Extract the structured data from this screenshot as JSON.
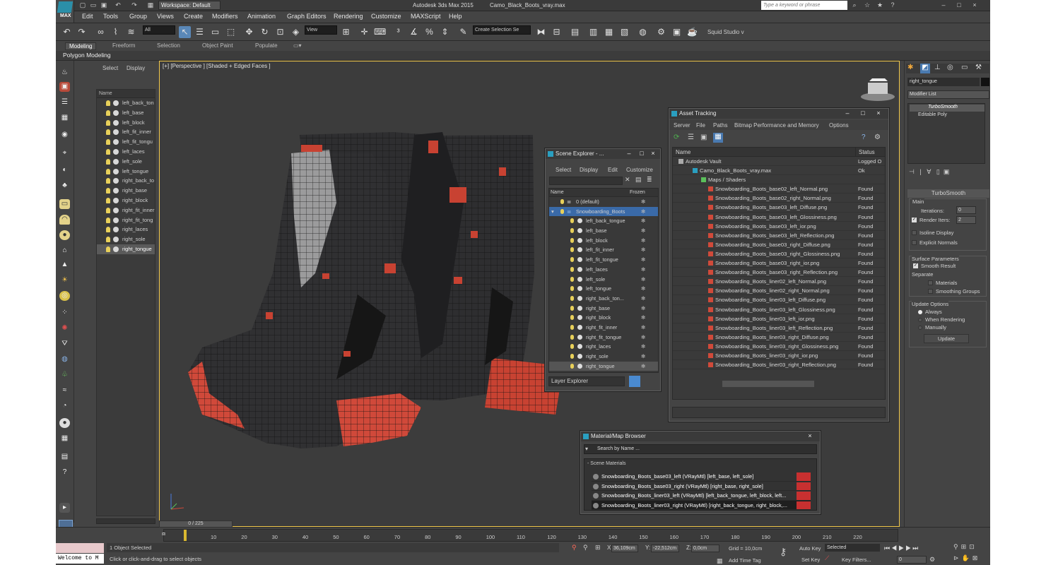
{
  "app": {
    "title": "Autodesk 3ds Max 2015",
    "file": "Camo_Black_Boots_vray.max",
    "logo": "MAX",
    "search_placeholder": "Type a keyword or phrase",
    "workspace": "Workspace: Default"
  },
  "menu": [
    "Edit",
    "Tools",
    "Group",
    "Views",
    "Create",
    "Modifiers",
    "Animation",
    "Graph Editors",
    "Rendering",
    "Customize",
    "MAXScript",
    "Help"
  ],
  "toolbar": {
    "filter": "All",
    "view": "View",
    "selection_set": "Create Selection Se",
    "squid": "Squid Studio v"
  },
  "ribbon": {
    "tabs": [
      "Modeling",
      "Freeform",
      "Selection",
      "Object Paint",
      "Populate"
    ],
    "active": "Modeling",
    "sub": "Polygon Modeling"
  },
  "left_panel": {
    "tabs": [
      "Select",
      "Display"
    ],
    "col": "Name",
    "items": [
      "left_back_ton",
      "left_base",
      "left_block",
      "left_fit_inner",
      "left_fit_tongu",
      "left_laces",
      "left_sole",
      "left_tongue",
      "right_back_to",
      "right_base",
      "right_block",
      "right_fit_inner",
      "right_fit_tong",
      "right_laces",
      "right_sole",
      "right_tongue"
    ],
    "selected": "right_tongue"
  },
  "viewport": {
    "label": "[+] [Perspective ] [Shaded + Edged Faces ]",
    "time": "0 / 225"
  },
  "scene_explorer": {
    "title": "Scene Explorer - ...",
    "menu": [
      "Select",
      "Display",
      "Edit",
      "Customize"
    ],
    "cols": [
      "Name",
      "Frozen"
    ],
    "root": "0 (default)",
    "group": "Snowboarding_Boots",
    "items": [
      "left_back_tongue",
      "left_base",
      "left_block",
      "left_fit_inner",
      "left_fit_tongue",
      "left_laces",
      "left_sole",
      "left_tongue",
      "right_back_ton...",
      "right_base",
      "right_block",
      "right_fit_inner",
      "right_fit_tongue",
      "right_laces",
      "right_sole",
      "right_tongue"
    ],
    "footer": "Layer Explorer"
  },
  "asset_tracking": {
    "title": "Asset Tracking",
    "menu": [
      "Server",
      "File",
      "Paths",
      "Bitmap Performance and Memory",
      "Options"
    ],
    "cols": [
      "Name",
      "Status"
    ],
    "rows": [
      {
        "n": "Autodesk Vault",
        "s": "Logged O",
        "l": 1
      },
      {
        "n": "Camo_Black_Boots_vray.max",
        "s": "Ok",
        "l": 2
      },
      {
        "n": "Maps / Shaders",
        "s": "",
        "l": 3
      },
      {
        "n": "Snowboarding_Boots_base02_left_Normal.png",
        "s": "Found",
        "l": 4
      },
      {
        "n": "Snowboarding_Boots_base02_right_Normal.png",
        "s": "Found",
        "l": 4
      },
      {
        "n": "Snowboarding_Boots_base03_left_Diffuse.png",
        "s": "Found",
        "l": 4
      },
      {
        "n": "Snowboarding_Boots_base03_left_Glossiness.png",
        "s": "Found",
        "l": 4
      },
      {
        "n": "Snowboarding_Boots_base03_left_ior.png",
        "s": "Found",
        "l": 4
      },
      {
        "n": "Snowboarding_Boots_base03_left_Reflection.png",
        "s": "Found",
        "l": 4
      },
      {
        "n": "Snowboarding_Boots_base03_right_Diffuse.png",
        "s": "Found",
        "l": 4
      },
      {
        "n": "Snowboarding_Boots_base03_right_Glossiness.png",
        "s": "Found",
        "l": 4
      },
      {
        "n": "Snowboarding_Boots_base03_right_ior.png",
        "s": "Found",
        "l": 4
      },
      {
        "n": "Snowboarding_Boots_base03_right_Reflection.png",
        "s": "Found",
        "l": 4
      },
      {
        "n": "Snowboarding_Boots_liner02_left_Normal.png",
        "s": "Found",
        "l": 4
      },
      {
        "n": "Snowboarding_Boots_liner02_right_Normal.png",
        "s": "Found",
        "l": 4
      },
      {
        "n": "Snowboarding_Boots_liner03_left_Diffuse.png",
        "s": "Found",
        "l": 4
      },
      {
        "n": "Snowboarding_Boots_liner03_left_Glossiness.png",
        "s": "Found",
        "l": 4
      },
      {
        "n": "Snowboarding_Boots_liner03_left_ior.png",
        "s": "Found",
        "l": 4
      },
      {
        "n": "Snowboarding_Boots_liner03_left_Reflection.png",
        "s": "Found",
        "l": 4
      },
      {
        "n": "Snowboarding_Boots_liner03_right_Diffuse.png",
        "s": "Found",
        "l": 4
      },
      {
        "n": "Snowboarding_Boots_liner03_right_Glossiness.png",
        "s": "Found",
        "l": 4
      },
      {
        "n": "Snowboarding_Boots_liner03_right_ior.png",
        "s": "Found",
        "l": 4
      },
      {
        "n": "Snowboarding_Boots_liner03_right_Reflection.png",
        "s": "Found",
        "l": 4
      }
    ]
  },
  "material_browser": {
    "title": "Material/Map Browser",
    "search": "Search by Name ...",
    "section": "- Scene Materials",
    "items": [
      "Snowboarding_Boots_base03_left (VRayMtl) [left_base, left_sole]",
      "Snowboarding_Boots_base03_right (VRayMtl) [right_base, right_sole]",
      "Snowboarding_Boots_liner03_left (VRayMtl) [left_back_tongue, left_block, left...",
      "Snowboarding_Boots_liner03_right (VRayMtl) [right_back_tongue, right_block,..."
    ]
  },
  "command_panel": {
    "object": "right_tongue",
    "modlist": "Modifier List",
    "stack": [
      "TurboSmooth",
      "Editable Poly"
    ],
    "rollout": "TurboSmooth",
    "main": "Main",
    "iterations_label": "Iterations:",
    "iterations": "0",
    "render_iters_label": "Render Iters:",
    "render_iters": "2",
    "isoline": "Isoline Display",
    "explicit": "Explicit Normals",
    "surface": "Surface Parameters",
    "smooth": "Smooth Result",
    "separate": "Separate",
    "materials": "Materials",
    "smoothing": "Smoothing Groups",
    "update_opts": "Update Options",
    "always": "Always",
    "when_rendering": "When Rendering",
    "manually": "Manually",
    "update": "Update"
  },
  "timeline": {
    "ticks": [
      "10",
      "20",
      "30",
      "40",
      "50",
      "60",
      "70",
      "80",
      "90",
      "100",
      "110",
      "120",
      "130",
      "140",
      "150",
      "160",
      "170",
      "180",
      "190",
      "200",
      "210",
      "220"
    ]
  },
  "status": {
    "selected": "1 Object Selected",
    "hint": "Click or click-and-drag to select objects",
    "welcome": "Welcome to M",
    "x_label": "X:",
    "x": "36,109cm",
    "y_label": "Y:",
    "y": "-22,512cm",
    "z_label": "Z:",
    "z": "0,0cm",
    "grid": "Grid = 10,0cm",
    "add_time_tag": "Add Time Tag",
    "auto_key": "Auto Key",
    "set_key": "Set Key",
    "key_mode": "Selected",
    "key_filters": "Key Filters...",
    "frame": "0"
  }
}
